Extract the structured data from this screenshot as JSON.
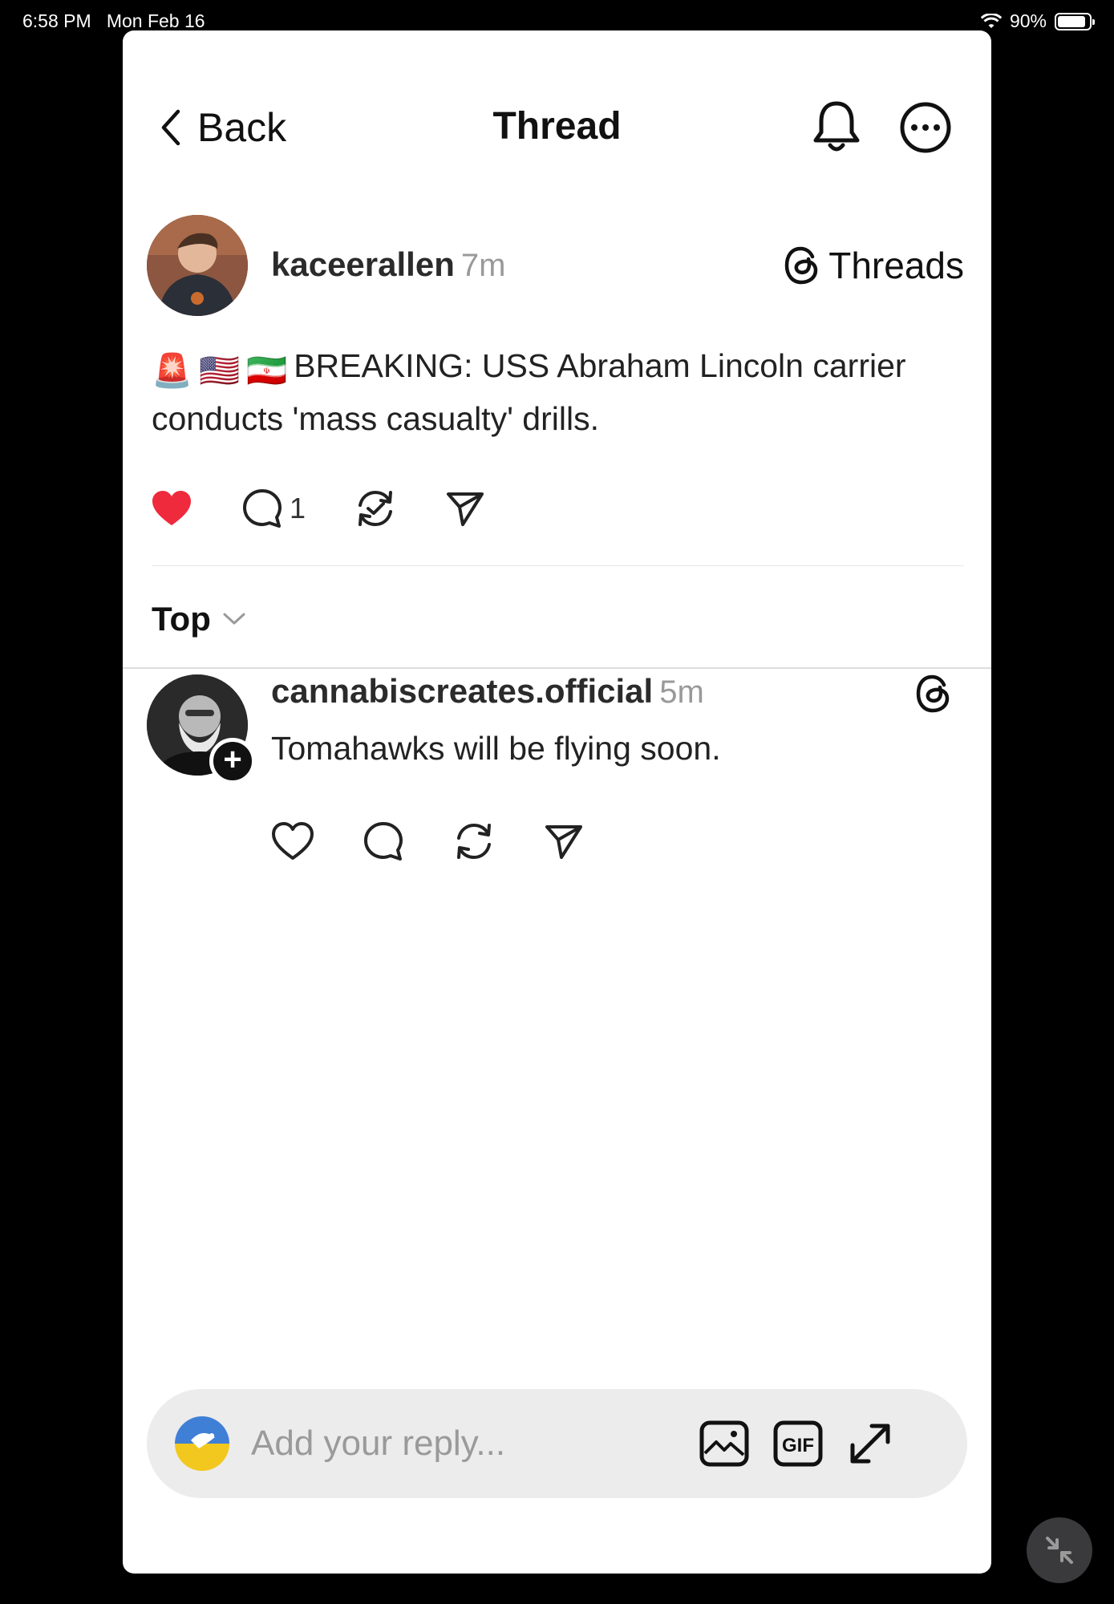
{
  "status_bar": {
    "time": "6:58 PM",
    "date": "Mon Feb 16",
    "battery": "90%",
    "battery_level": 0.9
  },
  "nav": {
    "back_label": "Back",
    "title": "Thread",
    "bell_icon": "bell-icon",
    "more_icon": "more-options-icon"
  },
  "post": {
    "username": "kaceerallen",
    "time": "7m",
    "brand": "Threads",
    "flags": [
      "🚨",
      "🇺🇸",
      "🇮🇷"
    ],
    "text": "BREAKING: USS Abraham Lincoln carrier conducts 'mass casualty' drills.",
    "liked": true,
    "reply_count": "1",
    "like_color": "#ee2a3c"
  },
  "sort": {
    "label": "Top"
  },
  "replies": [
    {
      "username": "cannabiscreates.official",
      "time": "5m",
      "text": "Tomahawks will be flying soon.",
      "follow_symbol": "+"
    }
  ],
  "composer": {
    "placeholder": "Add your reply...",
    "value": "",
    "gif_label": "GIF"
  }
}
